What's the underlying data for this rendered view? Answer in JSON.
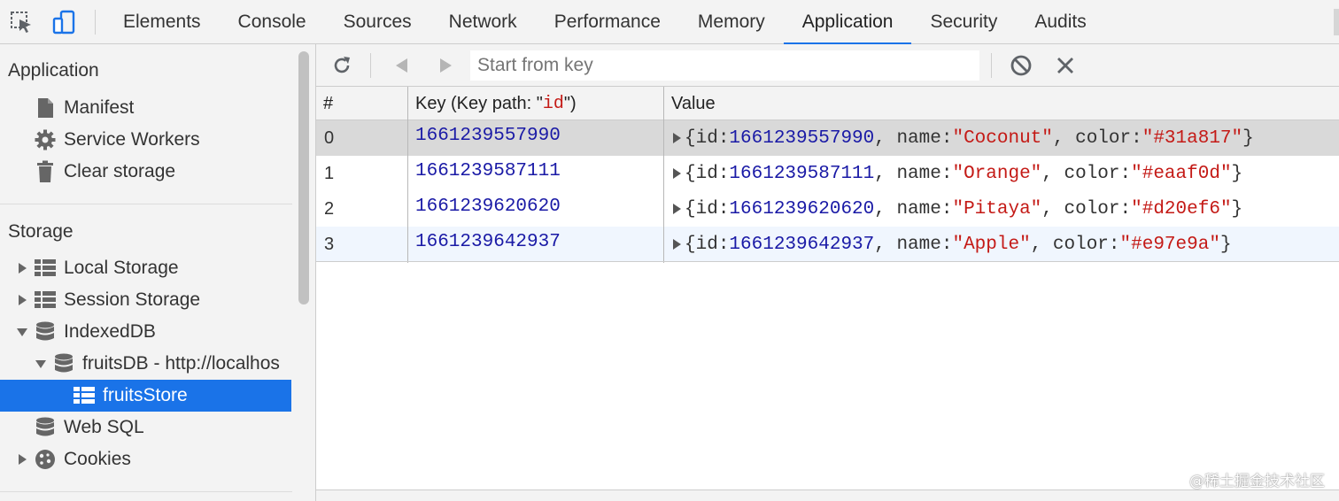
{
  "devtools": {
    "tabs": [
      {
        "label": "Elements"
      },
      {
        "label": "Console"
      },
      {
        "label": "Sources"
      },
      {
        "label": "Network"
      },
      {
        "label": "Performance"
      },
      {
        "label": "Memory"
      },
      {
        "label": "Application",
        "active": true
      },
      {
        "label": "Security"
      },
      {
        "label": "Audits"
      }
    ],
    "accent_color": "#1a73e8"
  },
  "sidebar": {
    "application_title": "Application",
    "application_items": [
      {
        "label": "Manifest",
        "icon": "document-icon"
      },
      {
        "label": "Service Workers",
        "icon": "gear-icon"
      },
      {
        "label": "Clear storage",
        "icon": "trash-icon"
      }
    ],
    "storage_title": "Storage",
    "storage_items": [
      {
        "label": "Local Storage",
        "icon": "grid-icon",
        "expanded": false
      },
      {
        "label": "Session Storage",
        "icon": "grid-icon",
        "expanded": false
      },
      {
        "label": "IndexedDB",
        "icon": "database-icon",
        "expanded": true
      },
      {
        "label": "fruitsDB - http://localhos",
        "icon": "database-icon",
        "expanded": true
      },
      {
        "label": "fruitsStore",
        "icon": "grid-icon",
        "selected": true
      },
      {
        "label": "Web SQL",
        "icon": "database-icon"
      },
      {
        "label": "Cookies",
        "icon": "cookie-icon",
        "expanded": false
      }
    ]
  },
  "toolbar": {
    "search_placeholder": "Start from key",
    "buttons": [
      "refresh-icon",
      "previous-icon",
      "next-icon",
      "clear-icon",
      "delete-icon"
    ]
  },
  "table": {
    "headers": {
      "index": "#",
      "key_prefix": "Key (Key path: \"",
      "key_path": "id",
      "key_suffix": "\")",
      "value": "Value"
    },
    "rows": [
      {
        "index": "0",
        "key": "1661239557990",
        "id": "1661239557990",
        "name": "\"Coconut\"",
        "color": "\"#31a817\""
      },
      {
        "index": "1",
        "key": "1661239587111",
        "id": "1661239587111",
        "name": "\"Orange\"",
        "color": "\"#eaaf0d\""
      },
      {
        "index": "2",
        "key": "1661239620620",
        "id": "1661239620620",
        "name": "\"Pitaya\"",
        "color": "\"#d20ef6\""
      },
      {
        "index": "3",
        "key": "1661239642937",
        "id": "1661239642937",
        "name": "\"Apple\"",
        "color": "\"#e97e9a\""
      }
    ],
    "value_tokens": {
      "open": "{",
      "id_key": "id: ",
      "name_key": ", name: ",
      "color_key": ", color: ",
      "close": "}"
    }
  },
  "watermark": "@稀土掘金技术社区"
}
